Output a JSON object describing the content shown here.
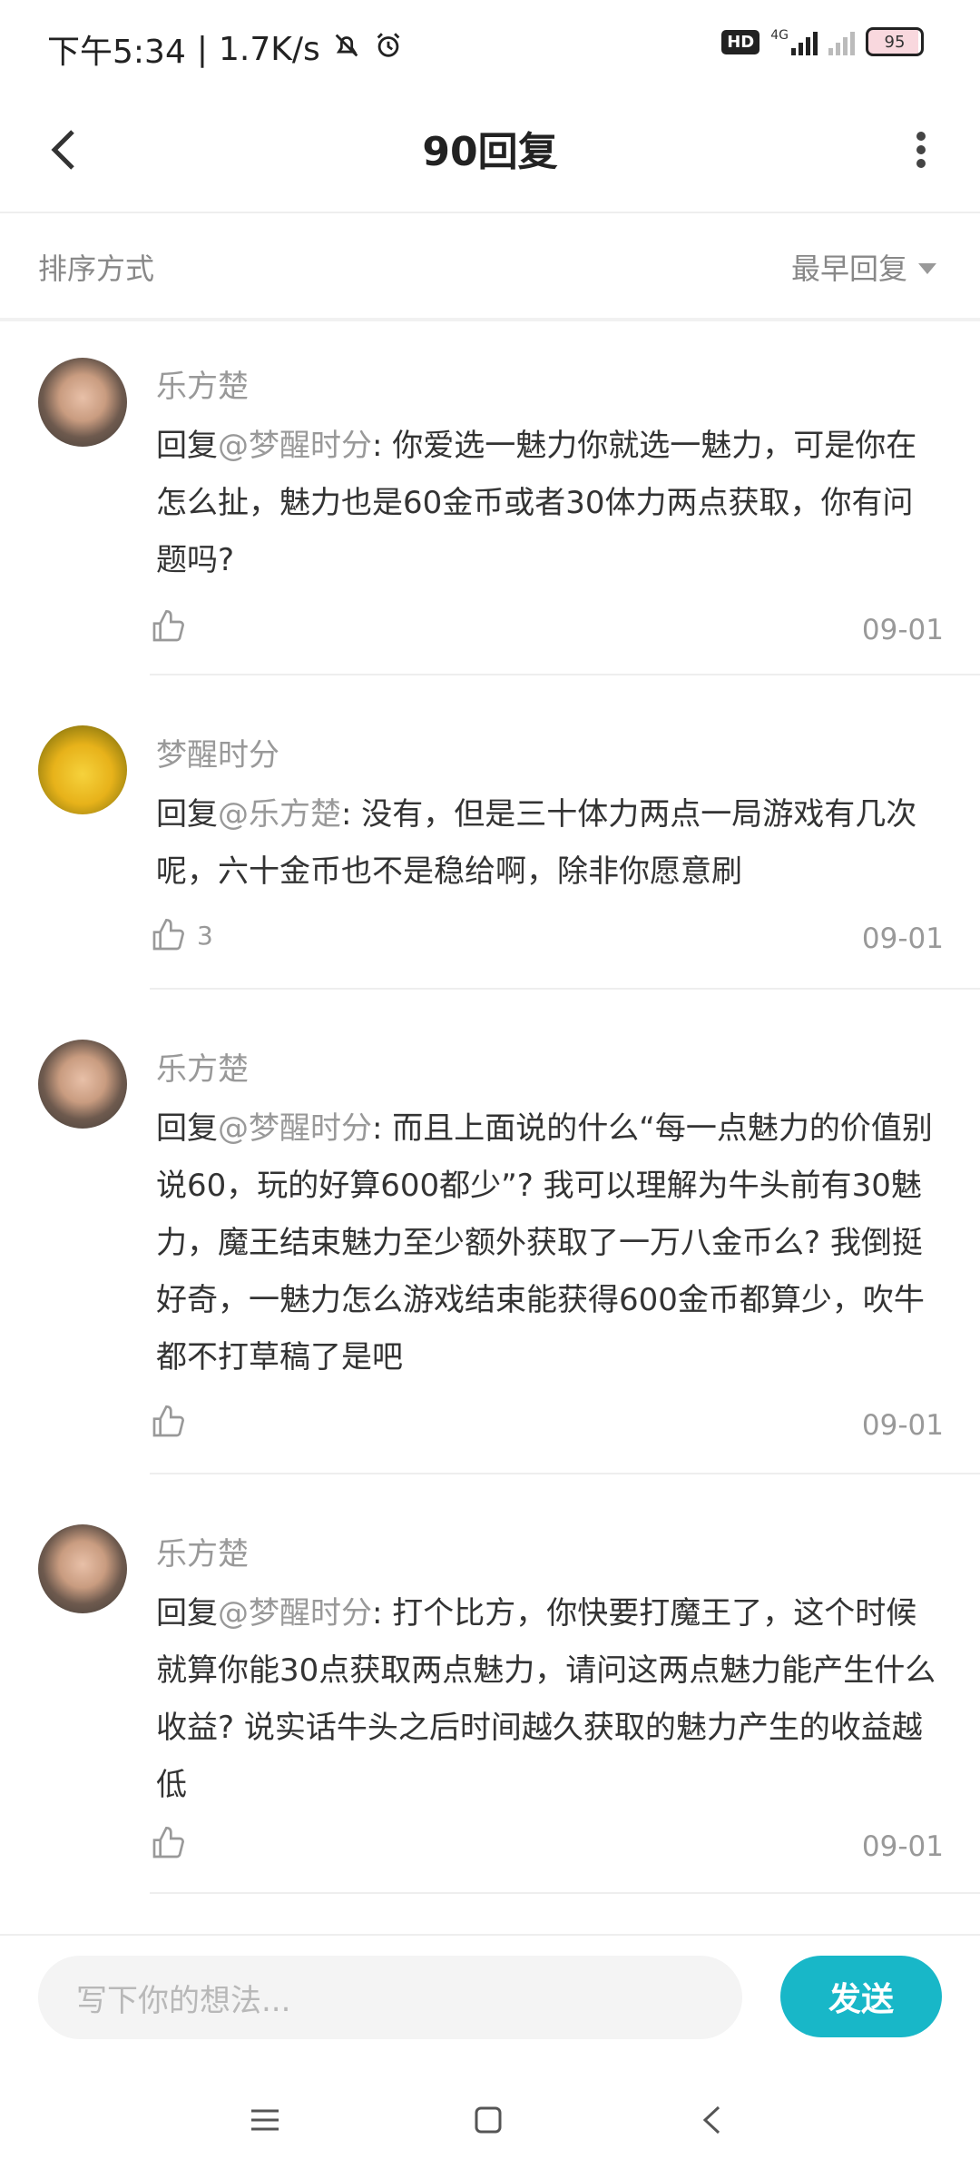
{
  "status_bar": {
    "time": "下午5:34",
    "speed": "1.7K/s",
    "hd": "HD",
    "net": "4G",
    "battery": "95"
  },
  "header": {
    "title": "90回复"
  },
  "sort": {
    "label": "排序方式",
    "value": "最早回复"
  },
  "comments": [
    {
      "author": "乐方楚",
      "reply_prefix": "回复",
      "mention": "@梦醒时分",
      "text": ": 你爱选一魅力你就选一魅力，可是你在怎么扯，魅力也是60金币或者30体力两点获取，你有问题吗?",
      "likes": "",
      "date": "09-01"
    },
    {
      "author": "梦醒时分",
      "reply_prefix": "回复",
      "mention": "@乐方楚",
      "text": ": 没有，但是三十体力两点一局游戏有几次呢，六十金币也不是稳给啊，除非你愿意刷",
      "likes": "3",
      "date": "09-01"
    },
    {
      "author": "乐方楚",
      "reply_prefix": "回复",
      "mention": "@梦醒时分",
      "text": ": 而且上面说的什么“每一点魅力的价值别说60，玩的好算600都少”? 我可以理解为牛头前有30魅力，魔王结束魅力至少额外获取了一万八金币么? 我倒挺好奇，一魅力怎么游戏结束能获得600金币都算少，吹牛都不打草稿了是吧",
      "likes": "",
      "date": "09-01"
    },
    {
      "author": "乐方楚",
      "reply_prefix": "回复",
      "mention": "@梦醒时分",
      "text": ": 打个比方，你快要打魔王了，这个时候就算你能30点获取两点魅力，请问这两点魅力能产生什么收益? 说实话牛头之后时间越久获取的魅力产生的收益越低",
      "likes": "",
      "date": "09-01"
    }
  ],
  "input": {
    "placeholder": "写下你的想法...",
    "send_label": "发送"
  },
  "colors": {
    "accent": "#18b7c8",
    "muted_text": "#999999",
    "body_text": "#333333"
  }
}
